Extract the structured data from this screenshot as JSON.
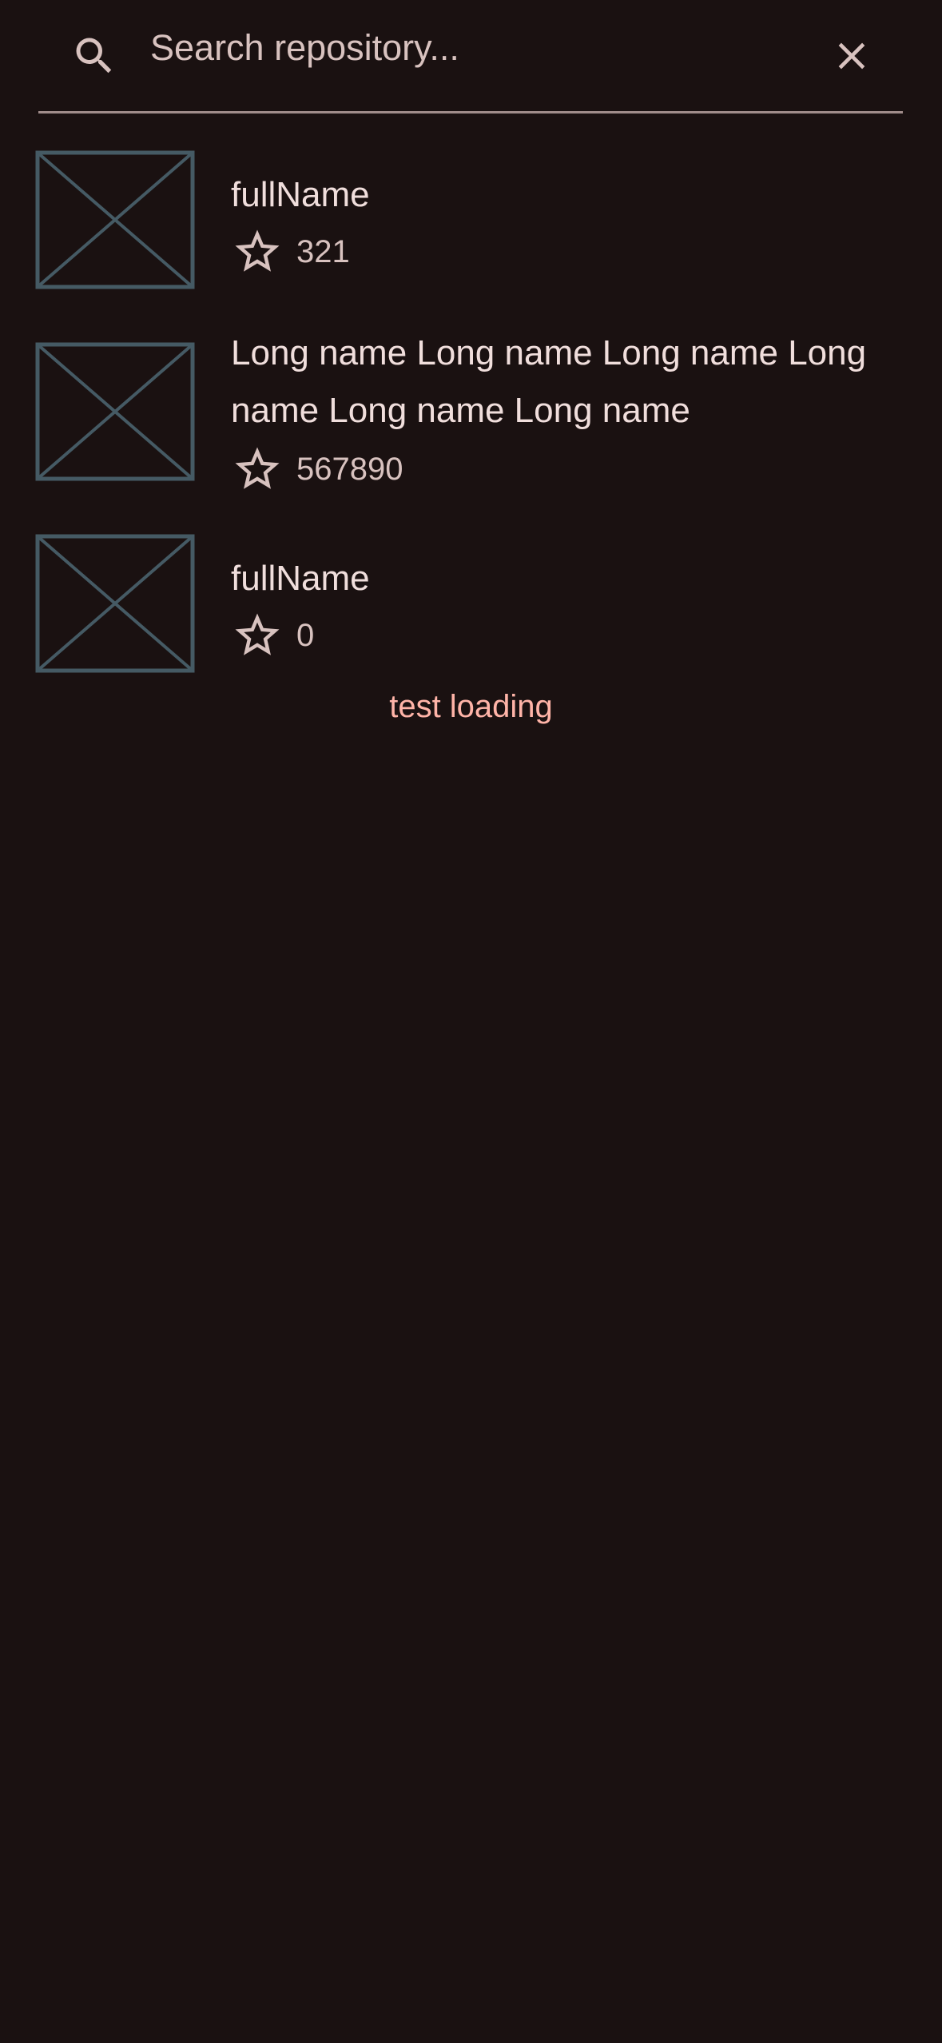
{
  "search": {
    "placeholder": "Search repository...",
    "value": ""
  },
  "repos": [
    {
      "name": "fullName",
      "stars": "321"
    },
    {
      "name": "Long name Long name Long name Long name Long name Long name",
      "stars": "567890"
    },
    {
      "name": "fullName",
      "stars": "0"
    }
  ],
  "status": {
    "loading_text": "test loading"
  },
  "colors": {
    "background": "#1a1111",
    "on_surface": "#f0dedc",
    "on_surface_variant": "#d8c2bf",
    "outline": "#a08c8a",
    "primary": "#ffb4a8",
    "placeholder_image": "#455a64"
  },
  "icons": {
    "search": "search-icon",
    "clear": "close-icon",
    "star": "star-outline-icon",
    "thumbnail": "image-placeholder"
  }
}
